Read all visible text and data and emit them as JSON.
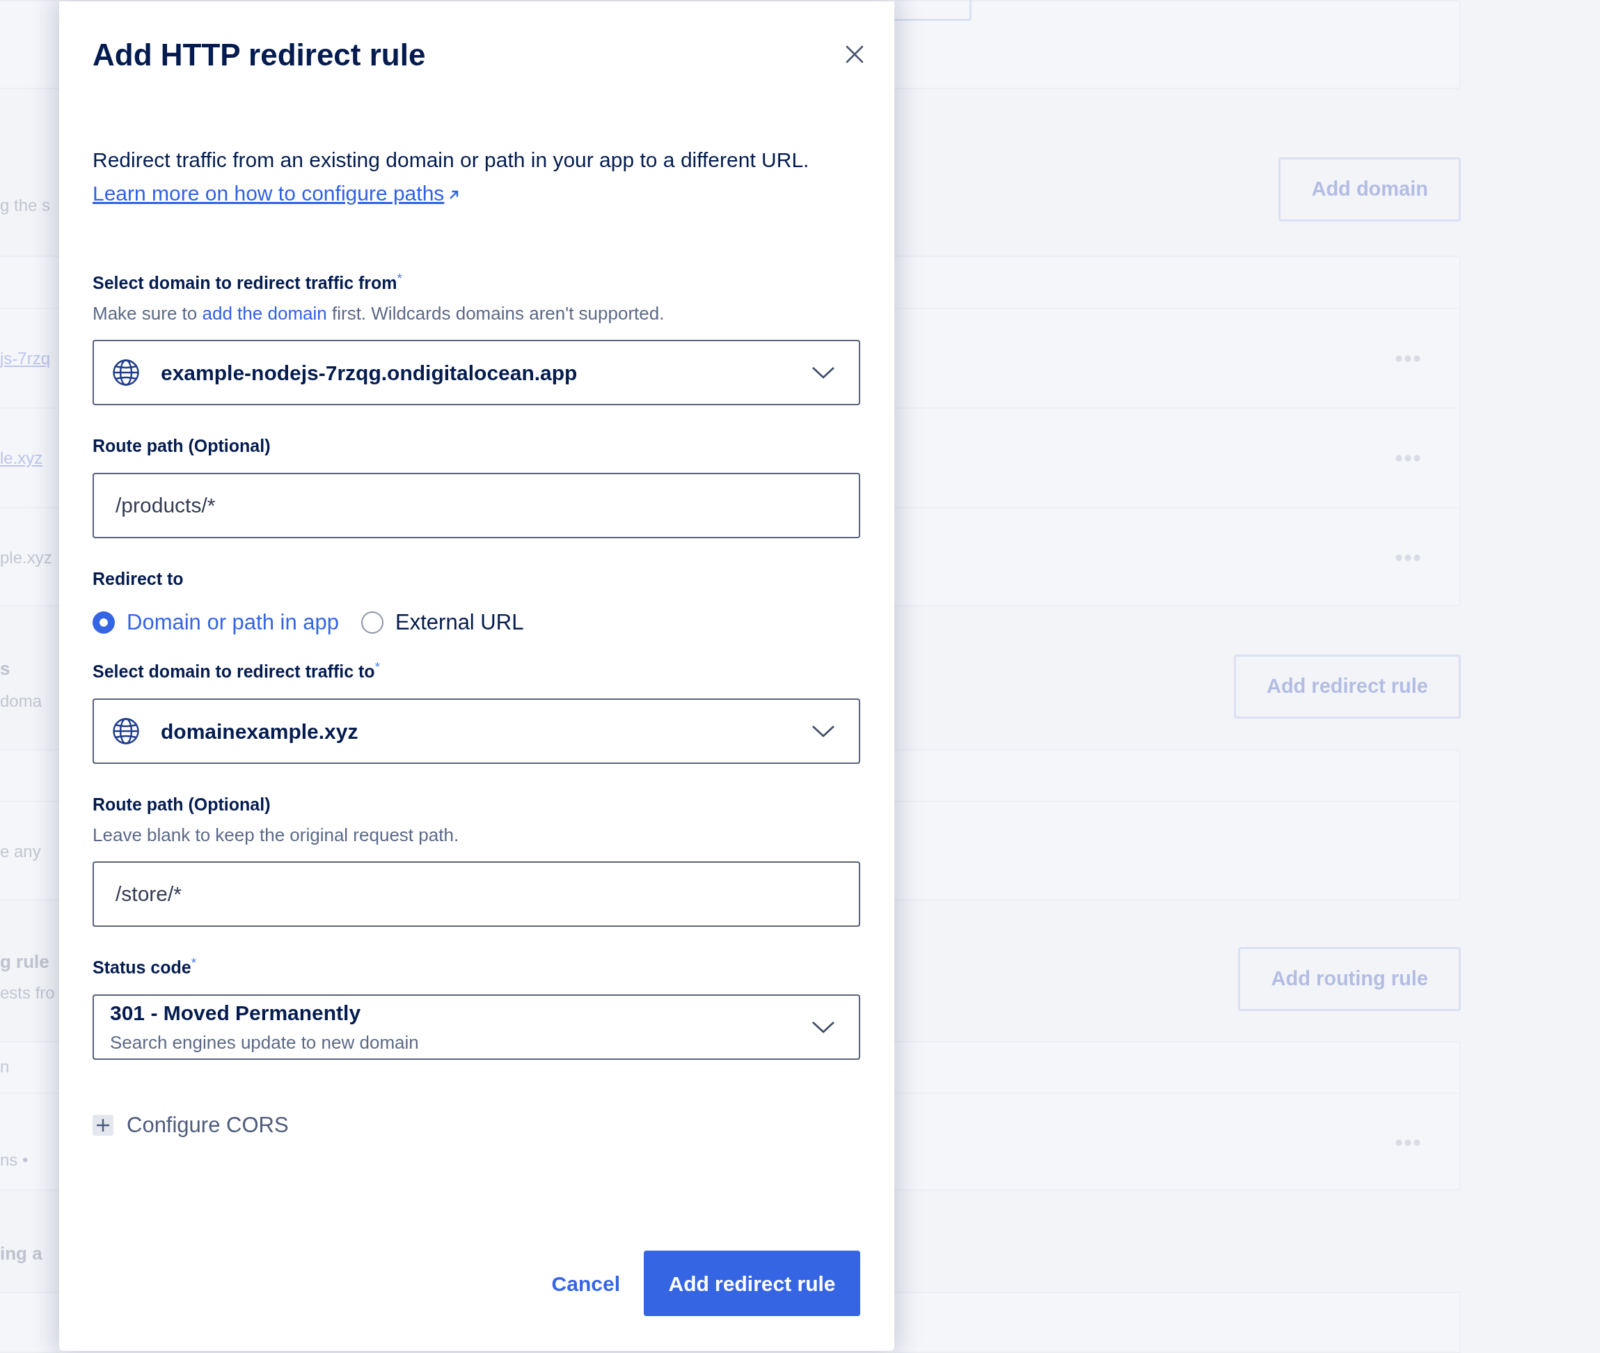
{
  "background": {
    "domains": {
      "description": "g the s",
      "button": "Add domain",
      "rows": [
        {
          "kind": "link",
          "domain": "js-7rzq"
        },
        {
          "kind": "link",
          "domain": "le.xyz"
        },
        {
          "kind": "text",
          "domain": "ple.xyz"
        }
      ]
    },
    "redirects": {
      "title": "s",
      "description": "doma",
      "button": "Add redirect rule",
      "empty_message": "e any"
    },
    "routing": {
      "title": "g rule",
      "description": "ests fro",
      "button": "Add routing rule",
      "header": "n",
      "rows": [
        {
          "detail": "ns •"
        }
      ]
    },
    "next_section": {
      "title": "ing a"
    }
  },
  "dialog": {
    "title": "Add HTTP redirect rule",
    "description": "Redirect traffic from an existing domain or path in your app to a different URL.",
    "help_link": "Learn more on how to configure paths",
    "fields": [
      {
        "kind": "select",
        "label": "Select domain to redirect traffic from$^{*}$",
        "help": [
          {
            "kind": "text",
            "text": "Make sure to "
          },
          {
            "kind": "link",
            "text": "add the domain"
          },
          {
            "kind": "text",
            "text": " first. Wildcards domains aren't supported."
          }
        ],
        "value": "example-nodejs-7rzqg.ondigitalocean.app"
      },
      {
        "kind": "input",
        "label": "Route path (Optional)",
        "value": "/products/*"
      },
      {
        "kind": "radio",
        "label": "Redirect to",
        "options": [
          {
            "label": "Domain or path in app",
            "selected": true
          },
          {
            "label": "External URL",
            "selected": false
          }
        ]
      },
      {
        "kind": "select",
        "label": "Select domain to redirect traffic to$^{*}$",
        "value": "domainexample.xyz"
      },
      {
        "kind": "input",
        "label": "Route path (Optional)",
        "help": [
          {
            "kind": "text",
            "text": "Leave blank to keep the original request path."
          }
        ],
        "value": "/store/*"
      },
      {
        "kind": "status_select",
        "label": "Status code$^{*}$",
        "value": "301 - Moved Permanently",
        "description": "Search engines update to new domain"
      }
    ],
    "cors": {
      "label": "Configure CORS",
      "expanded": false
    },
    "buttons": {
      "cancel": "Cancel",
      "submit": "Add redirect rule"
    }
  }
}
